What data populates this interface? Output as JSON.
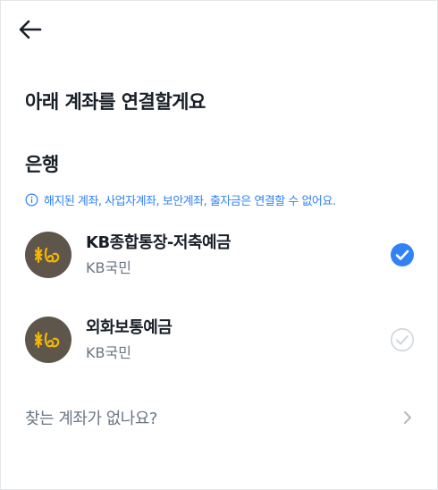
{
  "header": {
    "back_icon": "arrow-left-icon"
  },
  "page_title": "아래 계좌를 연결할게요",
  "section": {
    "title": "은행",
    "notice_icon": "info-icon",
    "notice": "해지된 계좌, 사업자계좌, 보안계좌, 출자금은 연결할 수 없어요."
  },
  "accounts": [
    {
      "name": "KB종합통장-저축예금",
      "bank": "KB국민",
      "logo_icon": "kb-star-logo-icon",
      "selected": true
    },
    {
      "name": "외화보통예금",
      "bank": "KB국민",
      "logo_icon": "kb-star-logo-icon",
      "selected": false
    }
  ],
  "footer": {
    "label": "찾는 계좌가 없나요?",
    "chevron_icon": "chevron-right-icon"
  },
  "colors": {
    "accent": "#3182f6",
    "text": "#191f28",
    "subtext": "#6b7684",
    "bank_logo_bg": "#5f564b",
    "bank_logo_star": "#f2b705",
    "unselected_check": "#d1d6db"
  }
}
